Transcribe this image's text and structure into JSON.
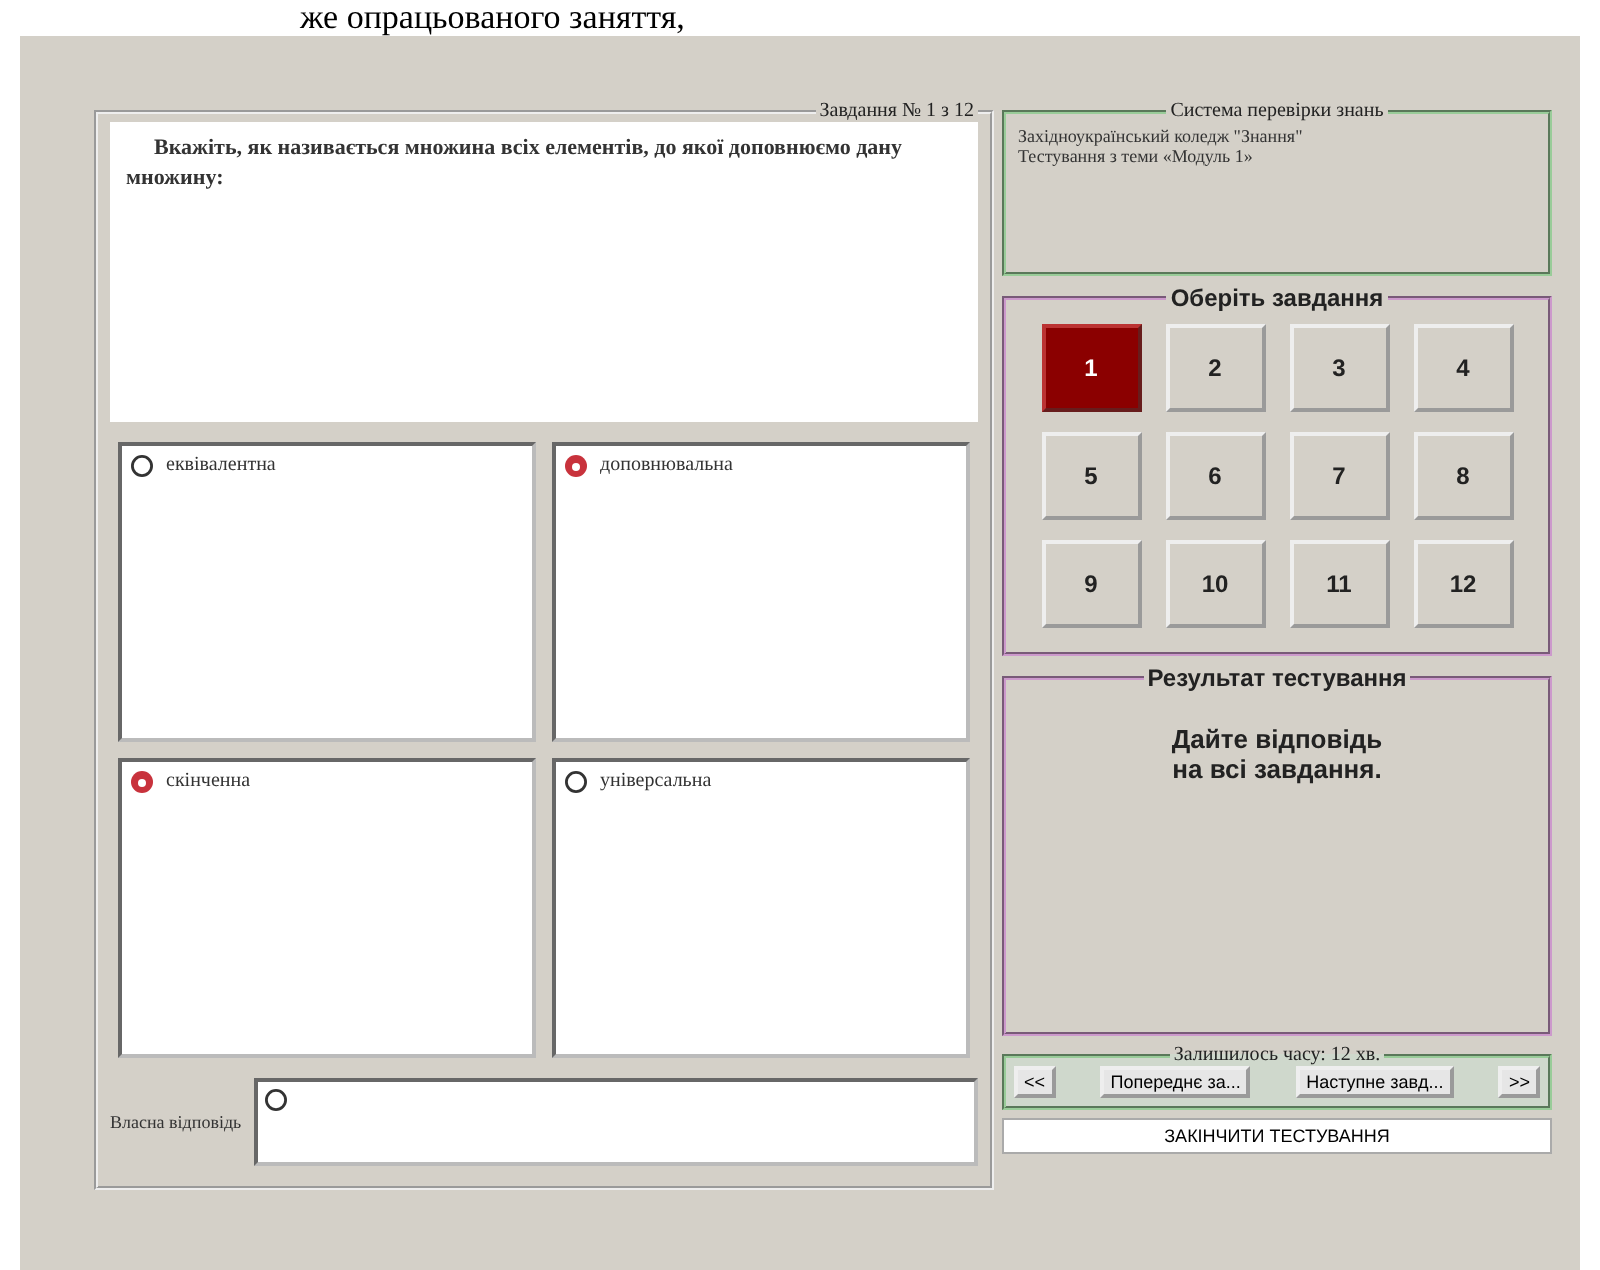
{
  "document_text": "же опрацьованого заняття,",
  "task_frame": {
    "title": "Завдання № 1 з 12",
    "question": "Вкажіть, як називається множина всіх елементів, до якої доповнюємо дану множину:"
  },
  "options": [
    {
      "label": "еквівалентна",
      "checked": false
    },
    {
      "label": "доповнювальна",
      "checked": true
    },
    {
      "label": "скінченна",
      "checked": true
    },
    {
      "label": "універсальна",
      "checked": false
    }
  ],
  "own_answer": {
    "label": "Власна відповідь",
    "checked": false
  },
  "system": {
    "title": "Система перевірки знань",
    "lines": [
      "Західноукраїнський коледж \"Знання\"",
      "Тестування з теми «Модуль 1»"
    ]
  },
  "task_picker": {
    "title": "Оберіть завдання",
    "tasks": [
      {
        "label": "1",
        "selected": true
      },
      {
        "label": "2",
        "selected": false
      },
      {
        "label": "3",
        "selected": false
      },
      {
        "label": "4",
        "selected": false
      },
      {
        "label": "5",
        "selected": false
      },
      {
        "label": "6",
        "selected": false
      },
      {
        "label": "7",
        "selected": false
      },
      {
        "label": "8",
        "selected": false
      },
      {
        "label": "9",
        "selected": false
      },
      {
        "label": "10",
        "selected": false
      },
      {
        "label": "11",
        "selected": false
      },
      {
        "label": "12",
        "selected": false
      }
    ]
  },
  "result": {
    "title": "Результат тестування",
    "message": "Дайте відповідь\nна всі завдання."
  },
  "navigation": {
    "timer": "Залишилось часу: 12 хв.",
    "buttons": [
      "<<",
      "Попереднє за...",
      "Наступне завд...",
      ">>"
    ]
  },
  "finish_button": "ЗАКІНЧИТИ ТЕСТУВАННЯ"
}
